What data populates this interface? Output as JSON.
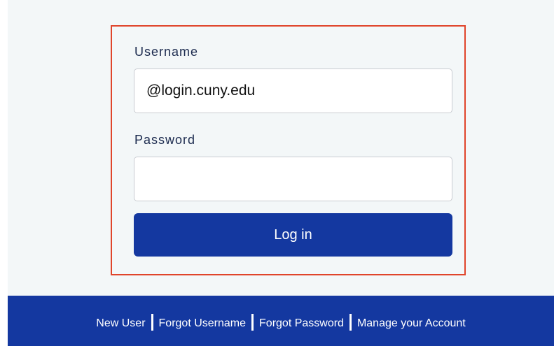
{
  "login_form": {
    "username_label": "Username",
    "username_value": "@login.cuny.edu",
    "password_label": "Password",
    "password_value": "",
    "login_button_label": "Log in"
  },
  "footer": {
    "links": [
      "New User",
      "Forgot Username",
      "Forgot Password",
      "Manage your Account"
    ]
  },
  "colors": {
    "brand_blue": "#1438a0",
    "highlight_border": "#e0452b",
    "background": "#f3f7f8",
    "label_text": "#1b2a4e"
  }
}
